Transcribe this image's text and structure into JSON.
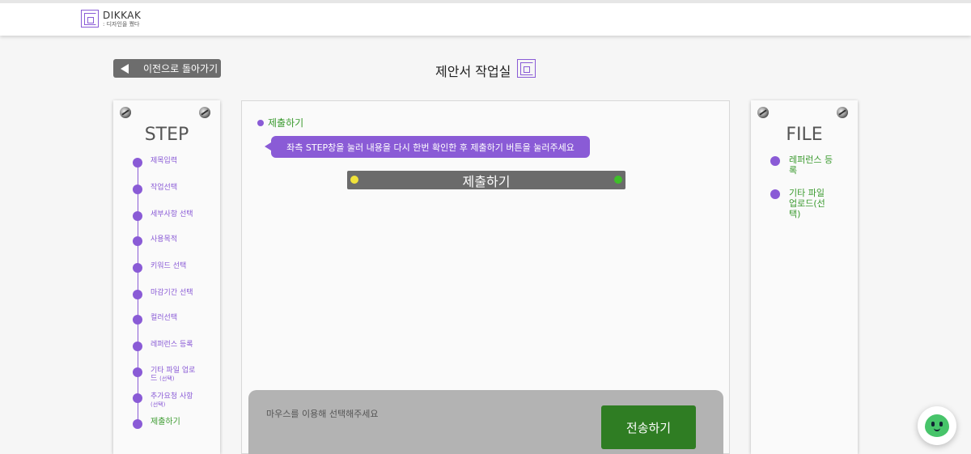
{
  "header": {
    "brand": "DIKKAK",
    "brand_sub": ": 디자인을 뀄다"
  },
  "nav": {
    "back_label": "이전으로 돌아가기"
  },
  "page": {
    "title": "제안서 작업실"
  },
  "steps_panel": {
    "heading": "STEP",
    "items": [
      {
        "label": "제목입력"
      },
      {
        "label": "작업선택"
      },
      {
        "label": "세부사항 선택"
      },
      {
        "label": "사용목적"
      },
      {
        "label": "키워드 선택"
      },
      {
        "label": "마감기간 선택"
      },
      {
        "label": "컬러선택"
      },
      {
        "label": "레퍼런스 등록"
      },
      {
        "label": "기타 파일 업로드",
        "note": "(선택)"
      },
      {
        "label": "추가요청 사항",
        "note": "(선택)"
      },
      {
        "label": "제출하기",
        "active": true
      }
    ]
  },
  "main": {
    "section_title": "제출하기",
    "tooltip": "좌측 STEP창을 눌러 내용을 다시 한번 확인한 후 제출하기 버튼을 눌러주세요",
    "submit_label": "제출하기",
    "input_placeholder": "마우스를 이용해 선택해주세요",
    "send_label": "전송하기"
  },
  "files_panel": {
    "heading": "FILE",
    "items": [
      {
        "label": "레퍼런스 등록"
      },
      {
        "label": "기타 파일 업로드(선택)"
      }
    ]
  },
  "colors": {
    "accent_purple": "#8a5bd6",
    "accent_green": "#3a9a2e",
    "send_green": "#2f7d23"
  }
}
